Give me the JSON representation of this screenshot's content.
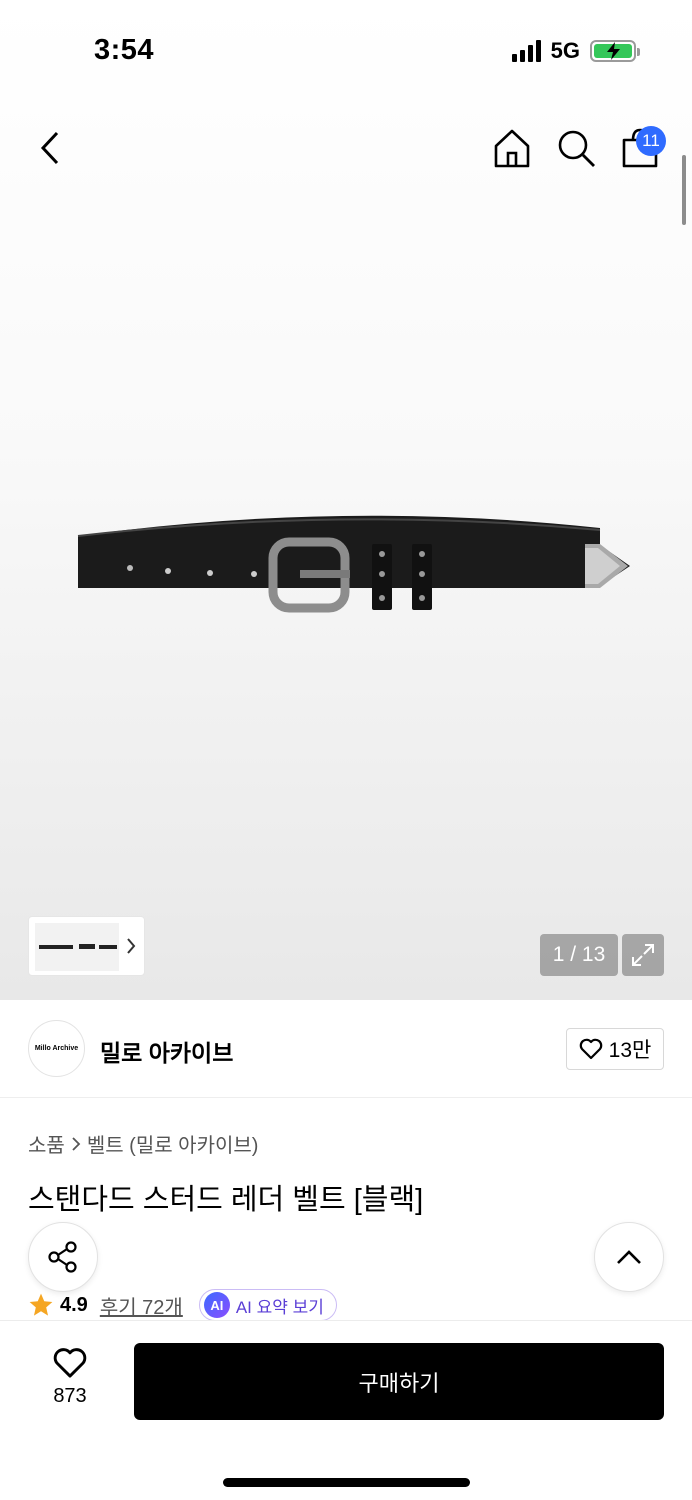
{
  "status": {
    "time": "3:54",
    "network": "5G"
  },
  "nav": {
    "cart_count": "11"
  },
  "gallery": {
    "counter": "1 / 13"
  },
  "brand": {
    "logo_text": "Millo Archive",
    "name": "밀로 아카이브",
    "likes": "13만"
  },
  "breadcrumb": {
    "level1": "소품",
    "level2": "벨트 (밀로 아카이브)"
  },
  "product": {
    "title": "스탠다드 스터드 레더 벨트 [블랙]"
  },
  "rating": {
    "score": "4.9",
    "reviews": "후기 72개",
    "ai_badge": "AI",
    "ai_label": "AI 요약 보기"
  },
  "bottom": {
    "wish_count": "873",
    "buy_label": "구매하기"
  },
  "colors": {
    "accent_blue": "#2f6bff",
    "rating_star": "#f5a623",
    "ai_purple": "#5b3fd6",
    "battery_green": "#34c759"
  },
  "icons": [
    "back-icon",
    "home-icon",
    "search-icon",
    "cart-icon",
    "chevron-right-icon",
    "expand-icon",
    "heart-icon",
    "share-icon",
    "chevron-up-icon",
    "star-icon"
  ]
}
